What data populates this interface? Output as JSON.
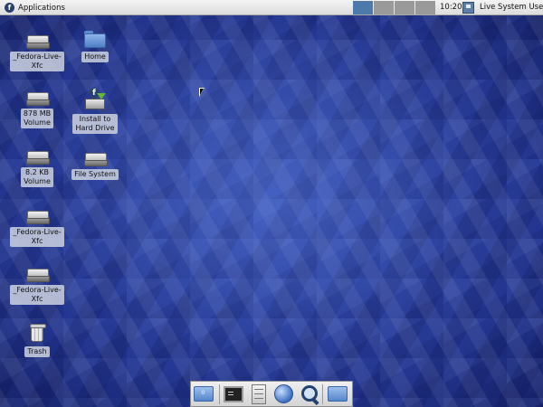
{
  "top_panel": {
    "applications_label": "Applications",
    "clock": "10:20",
    "user_label": "Live System User",
    "workspaces": [
      {
        "name": "workspace-1",
        "active": true
      },
      {
        "name": "workspace-2",
        "active": false
      },
      {
        "name": "workspace-3",
        "active": false
      },
      {
        "name": "workspace-4",
        "active": false
      }
    ]
  },
  "desktop_icons": [
    {
      "label": "_Fedora-Live-\nXfc",
      "icon": "drive-icon"
    },
    {
      "label": "878 MB\nVolume",
      "icon": "drive-icon"
    },
    {
      "label": "8.2 KB\nVolume",
      "icon": "drive-icon"
    },
    {
      "label": "_Fedora-Live-\nXfc",
      "icon": "drive-icon"
    },
    {
      "label": "_Fedora-Live-\nXfc",
      "icon": "drive-icon"
    },
    {
      "label": "Trash",
      "icon": "trash-icon"
    },
    {
      "label": "Home",
      "icon": "home-folder-icon"
    },
    {
      "label": "Install to\nHard Drive",
      "icon": "installer-icon"
    },
    {
      "label": "File System",
      "icon": "drive-icon"
    }
  ],
  "dock": {
    "items": [
      "show-desktop-icon",
      "terminal-icon",
      "file-cabinet-icon",
      "web-browser-icon",
      "app-finder-icon",
      "folder-icon"
    ]
  },
  "colors": {
    "panel": "#e6e6e6",
    "workspace_active": "#4e79ab",
    "workspace_inactive": "#9a9a9a",
    "desktop_blue": "#2b3f9a",
    "fedora_logo": "#294172"
  }
}
